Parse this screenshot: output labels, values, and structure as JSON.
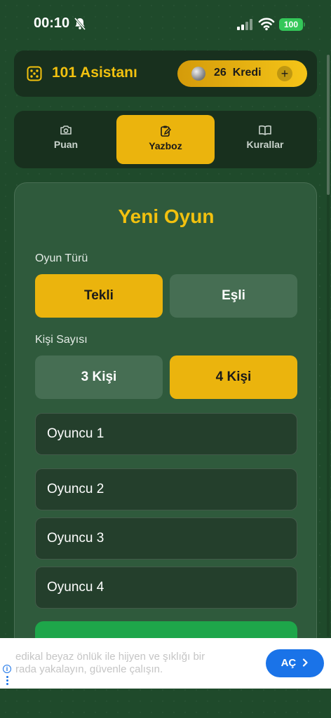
{
  "status_bar": {
    "time": "00:10",
    "battery": "100",
    "icons": [
      "bell-slash-icon",
      "signal-icon",
      "wifi-icon",
      "battery-icon"
    ]
  },
  "header": {
    "title": "101 Asistanı",
    "credits": "26",
    "credits_label": "Kredi",
    "add_label": "+",
    "icons": [
      "dice-icon",
      "coin-icon"
    ]
  },
  "tabs": [
    {
      "label": "Puan",
      "icon": "camera-icon",
      "active": false
    },
    {
      "label": "Yazboz",
      "icon": "clipboard-pen-icon",
      "active": true
    },
    {
      "label": "Kurallar",
      "icon": "book-icon",
      "active": false
    }
  ],
  "new_game": {
    "title": "Yeni Oyun",
    "game_type_label": "Oyun Türü",
    "game_types": [
      "Tekli",
      "Eşli"
    ],
    "selected_game_type": "Tekli",
    "player_count_label": "Kişi Sayısı",
    "player_counts": [
      "3 Kişi",
      "4 Kişi"
    ],
    "selected_player_count": "4 Kişi",
    "players": [
      "Oyuncu 1",
      "Oyuncu 2",
      "Oyuncu 3",
      "Oyuncu 4"
    ]
  },
  "ad": {
    "text_line1": "edikal beyaz önlük ile hijyen ve şıklığı bir",
    "text_line2": "rada yakalayın, güvenle çalışın.",
    "button_label": "AÇ"
  },
  "colors": {
    "background": "#1f4a2b",
    "accent": "#ebb40d",
    "title": "#f2c10f",
    "card": "#2f5a3c",
    "start_button": "#1ea64a",
    "ad_button": "#1a73e8"
  }
}
